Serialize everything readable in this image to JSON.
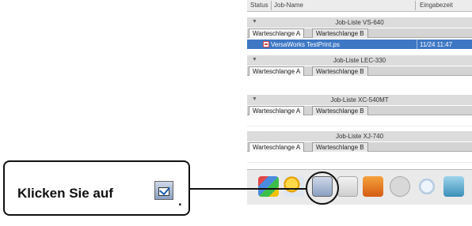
{
  "header": {
    "status": "Status",
    "job_name": "Job-Name",
    "received": "Eingabezeit"
  },
  "queues": [
    {
      "title": "Job-Liste VS-640",
      "tabs": [
        "Warteschlange A",
        "Warteschlange B"
      ],
      "selected_job": {
        "name": "VersaWorks TestPrint.ps",
        "time": "11/24 11:47"
      }
    },
    {
      "title": "Job-Liste LEC-330",
      "tabs": [
        "Warteschlange A",
        "Warteschlange B"
      ]
    },
    {
      "title": "Job-Liste XC-540MT",
      "tabs": [
        "Warteschlange A",
        "Warteschlange B"
      ]
    },
    {
      "title": "Job-Liste XJ-740",
      "tabs": [
        "Warteschlange A",
        "Warteschlange B"
      ]
    }
  ],
  "callout": {
    "text_prefix": "Klicken Sie auf",
    "text_suffix": ".",
    "icon": "job-settings-icon"
  },
  "toolbar_icons": [
    "grid-icon",
    "sun-wizard-icon",
    "job-settings-icon",
    "copy-icon",
    "print-icon",
    "stop-icon",
    "spinner-icon",
    "trash-icon"
  ],
  "colors": {
    "selection": "#3e78c4",
    "group_header": "#dcdcdc",
    "tab_row": "#d4d4d4"
  }
}
